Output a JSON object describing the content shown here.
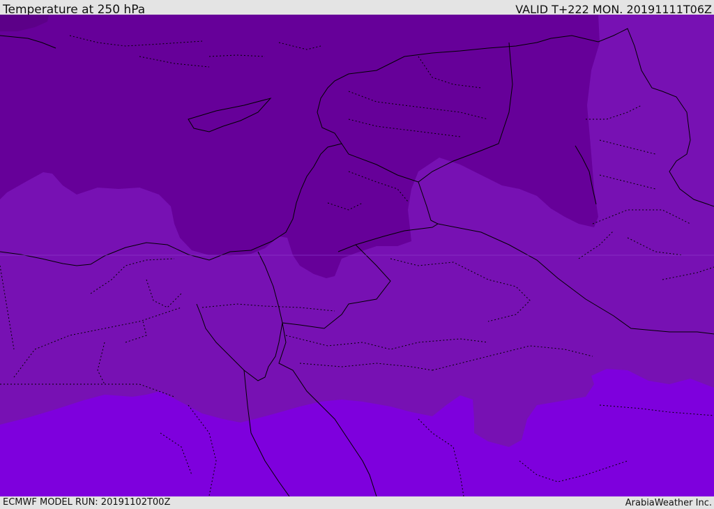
{
  "header": {
    "title": "Temperature at 250 hPa",
    "valid": "VALID T+222 MON. 20191111T06Z"
  },
  "footer": {
    "model_run": "ECMWF MODEL RUN: 20191102T00Z",
    "credit": "ArabiaWeather Inc."
  },
  "map": {
    "colors": {
      "dark_band": "#660099",
      "mid_band": "#7711b3",
      "light_band": "#7e00dd",
      "corner_band": "#5c0088",
      "border": "#000000"
    }
  }
}
